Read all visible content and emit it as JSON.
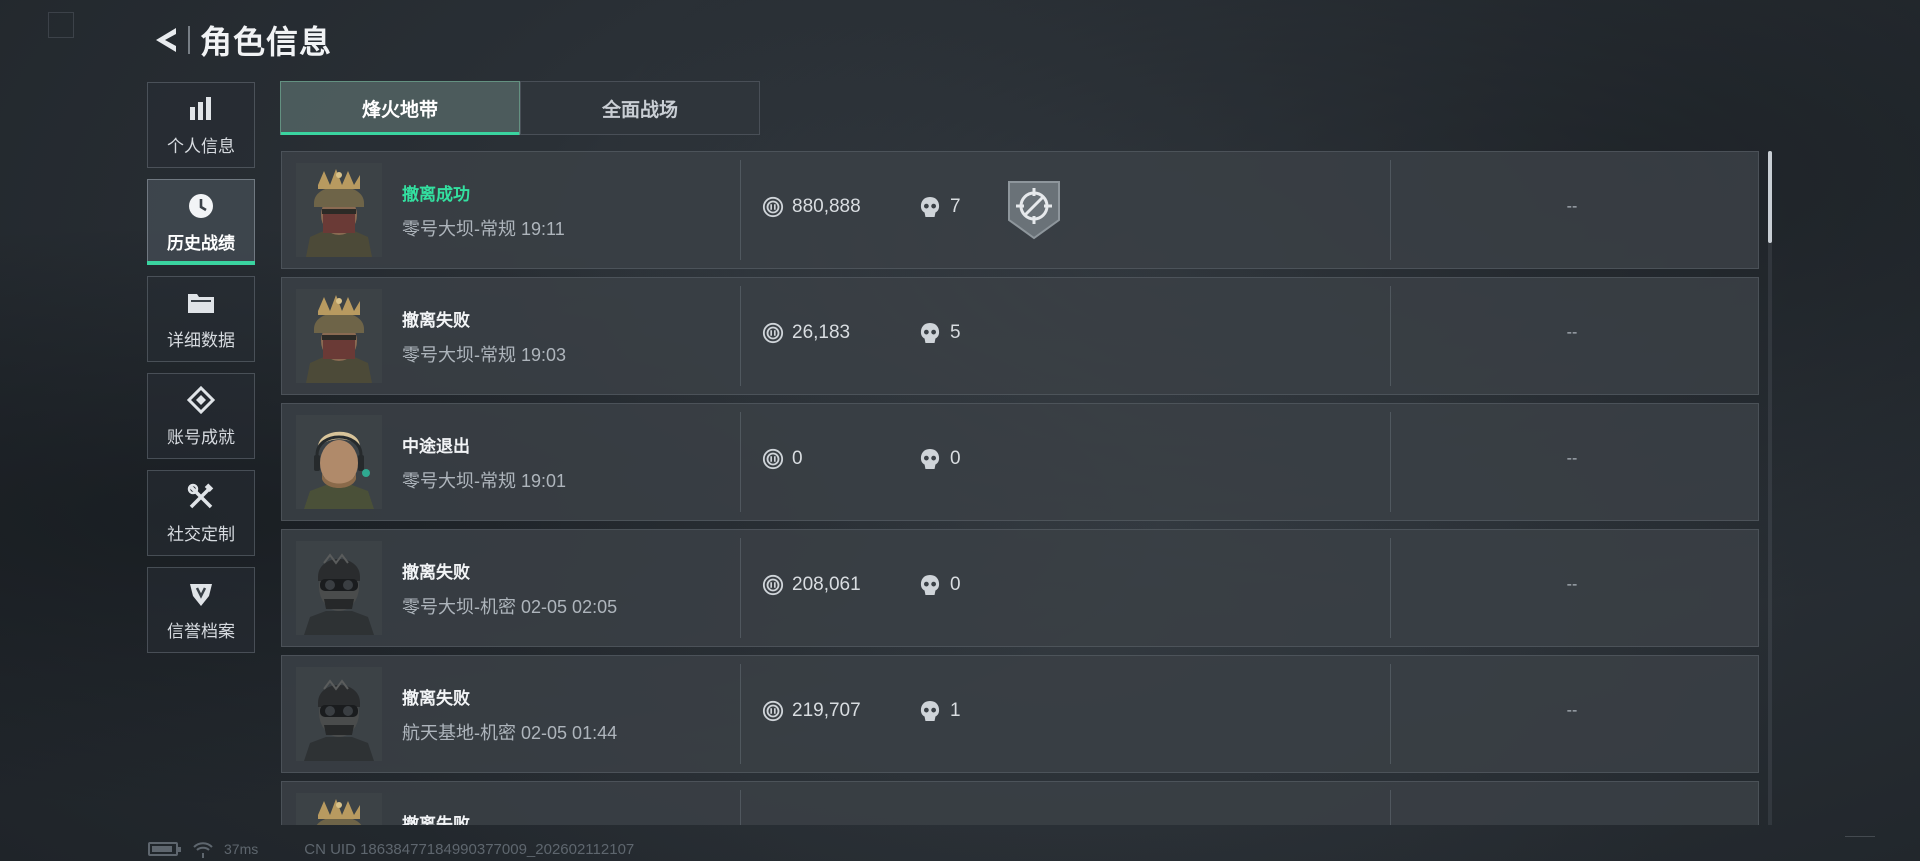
{
  "header": {
    "title": "角色信息"
  },
  "sidebar": {
    "items": [
      {
        "label": "个人信息",
        "icon": "bar-chart-icon",
        "active": false
      },
      {
        "label": "历史战绩",
        "icon": "clock-icon",
        "active": true
      },
      {
        "label": "详细数据",
        "icon": "folder-icon",
        "active": false
      },
      {
        "label": "账号成就",
        "icon": "achievement-icon",
        "active": false
      },
      {
        "label": "社交定制",
        "icon": "tools-icon",
        "active": false
      },
      {
        "label": "信誉档案",
        "icon": "shield-emblem-icon",
        "active": false
      }
    ]
  },
  "tabs": [
    {
      "label": "烽火地带",
      "active": true
    },
    {
      "label": "全面战场",
      "active": false
    }
  ],
  "records": [
    {
      "status": "撤离成功",
      "success": true,
      "map": "零号大坝-常规",
      "time": "19:11",
      "value": "880,888",
      "kills": "7",
      "badge": true,
      "extra": "--",
      "avatar": "helmet-crown"
    },
    {
      "status": "撤离失败",
      "success": false,
      "map": "零号大坝-常规",
      "time": "19:03",
      "value": "26,183",
      "kills": "5",
      "badge": false,
      "extra": "--",
      "avatar": "helmet-crown"
    },
    {
      "status": "中途退出",
      "success": false,
      "map": "零号大坝-常规",
      "time": "19:01",
      "value": "0",
      "kills": "0",
      "badge": false,
      "extra": "--",
      "avatar": "blond-headset"
    },
    {
      "status": "撤离失败",
      "success": false,
      "map": "零号大坝-机密",
      "time": "02-05 02:05",
      "value": "208,061",
      "kills": "0",
      "badge": false,
      "extra": "--",
      "avatar": "dark-goggles"
    },
    {
      "status": "撤离失败",
      "success": false,
      "map": "航天基地-机密",
      "time": "02-05 01:44",
      "value": "219,707",
      "kills": "1",
      "badge": false,
      "extra": "--",
      "avatar": "dark-goggles"
    },
    {
      "status": "撤离失败",
      "success": false,
      "map": "",
      "time": "",
      "value": "",
      "kills": "",
      "badge": false,
      "extra": "",
      "avatar": "helmet-crown"
    }
  ],
  "footer": {
    "ping": "37ms",
    "uid": "CN UID 18638477184990377009_202602112107"
  },
  "colors": {
    "accent": "#3ad4a0",
    "success": "#33e0a0"
  }
}
